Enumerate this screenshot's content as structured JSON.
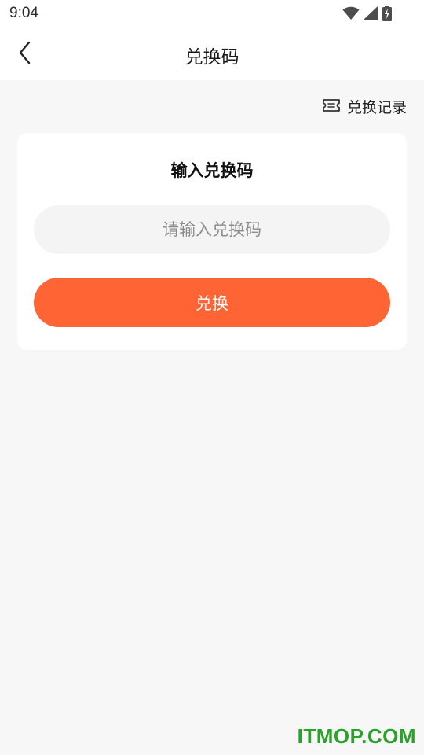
{
  "status_bar": {
    "time": "9:04",
    "icons": [
      "wifi-icon",
      "signal-icon",
      "battery-icon"
    ]
  },
  "nav": {
    "back_icon": "chevron-left-icon",
    "title": "兑换码"
  },
  "history_link": {
    "icon": "ticket-icon",
    "label": "兑换记录"
  },
  "card": {
    "title": "输入兑换码",
    "input": {
      "value": "",
      "placeholder": "请输入兑换码"
    },
    "button_label": "兑换"
  },
  "watermark": "ITMOP.COM",
  "colors": {
    "accent": "#fe6434",
    "background": "#f7f7f7",
    "card": "#ffffff",
    "input_bg": "#f4f4f4",
    "watermark": "#2aa12a"
  }
}
